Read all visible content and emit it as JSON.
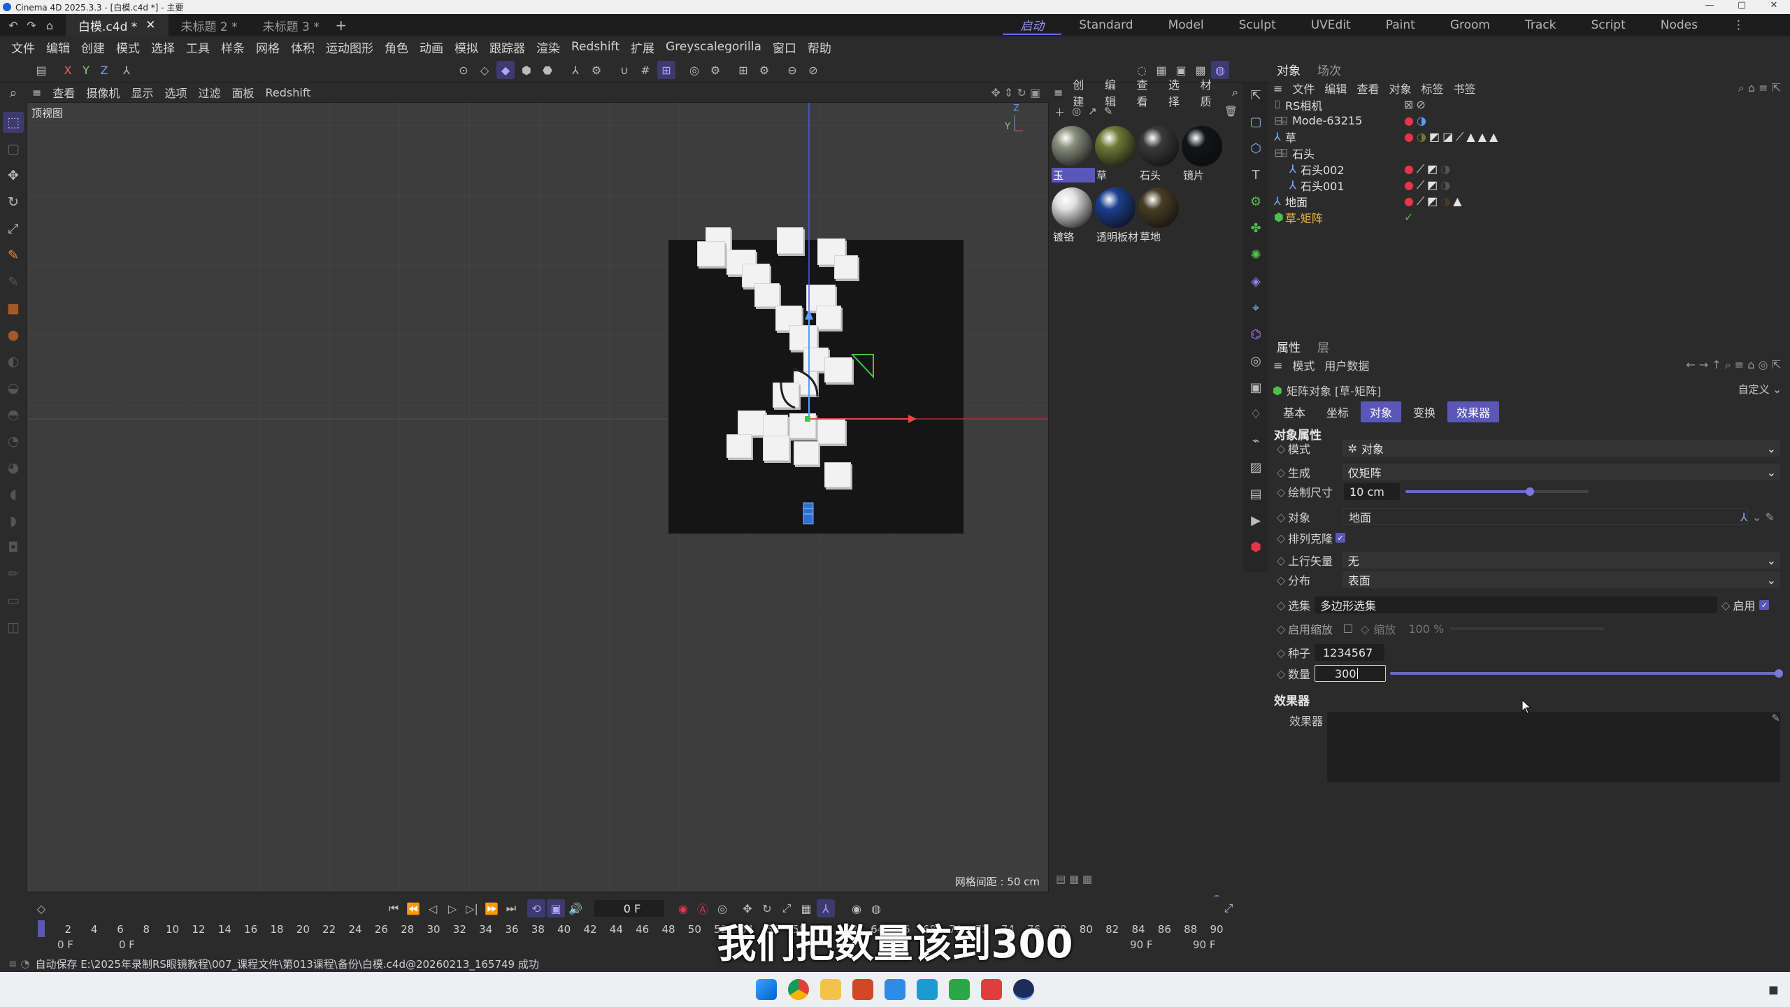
{
  "window": {
    "title": "Cinema 4D 2025.3.3 - [白模.c4d *] - 主要",
    "controls": [
      "—",
      "▢",
      "✕"
    ]
  },
  "tabs": [
    {
      "label": "白模.c4d *",
      "active": true
    },
    {
      "label": "未标题 2 *"
    },
    {
      "label": "未标题 3 *"
    }
  ],
  "layouts": [
    {
      "label": "启动",
      "active": true
    },
    {
      "label": "Standard"
    },
    {
      "label": "Model"
    },
    {
      "label": "Sculpt"
    },
    {
      "label": "UVEdit"
    },
    {
      "label": "Paint"
    },
    {
      "label": "Groom"
    },
    {
      "label": "Track"
    },
    {
      "label": "Script"
    },
    {
      "label": "Nodes"
    }
  ],
  "menu": [
    "文件",
    "编辑",
    "创建",
    "模式",
    "选择",
    "工具",
    "样条",
    "网格",
    "体积",
    "运动图形",
    "角色",
    "动画",
    "模拟",
    "跟踪器",
    "渲染",
    "Redshift",
    "扩展",
    "Greyscalegorilla",
    "窗口",
    "帮助"
  ],
  "axis_toggles": [
    "X",
    "Y",
    "Z"
  ],
  "viewport": {
    "menu": [
      "查看",
      "摄像机",
      "显示",
      "选项",
      "过滤",
      "面板",
      "Redshift"
    ],
    "label": "顶视图",
    "grid_info": "网格间距 : 50 cm"
  },
  "materials": {
    "menu": [
      "创建",
      "编辑",
      "查看",
      "选择",
      "材质"
    ],
    "items": [
      {
        "name": "玉",
        "color": "#8a8f7e"
      },
      {
        "name": "草",
        "color": "#6f7a35"
      },
      {
        "name": "石头",
        "color": "#3a3a3a"
      },
      {
        "name": "镜片",
        "color": "#111416"
      },
      {
        "name": "镀铬",
        "color": "#e0e0e0"
      },
      {
        "name": "透明板材",
        "color": "#1c3f8f"
      },
      {
        "name": "草地",
        "color": "#4a3d26"
      }
    ]
  },
  "object_manager": {
    "tabs": [
      "对象",
      "场次"
    ],
    "menu": [
      "文件",
      "编辑",
      "查看",
      "对象",
      "标签",
      "书签"
    ],
    "tree": [
      {
        "name": "RS相机",
        "indent": 0
      },
      {
        "name": "Mode-63215",
        "indent": 0
      },
      {
        "name": "草",
        "indent": 0
      },
      {
        "name": "石头",
        "indent": 0
      },
      {
        "name": "石头002",
        "indent": 1
      },
      {
        "name": "石头001",
        "indent": 1
      },
      {
        "name": "地面",
        "indent": 0
      },
      {
        "name": "草-矩阵",
        "indent": 0,
        "selected": true
      }
    ]
  },
  "attributes": {
    "tabs": [
      "属性",
      "层"
    ],
    "menu": [
      "模式",
      "用户数据"
    ],
    "object_title": "矩阵对象 [草-矩阵]",
    "preset": "自定义",
    "subtabs": [
      {
        "label": "基本"
      },
      {
        "label": "坐标"
      },
      {
        "label": "对象",
        "active": true
      },
      {
        "label": "变换"
      },
      {
        "label": "效果器",
        "active": true
      }
    ],
    "section": "对象属性",
    "mode_label": "模式",
    "mode_value": "对象",
    "generate_label": "生成",
    "generate_value": "仅矩阵",
    "draw_size_label": "绘制尺寸",
    "draw_size_value": "10 cm",
    "draw_size_fraction": 0.68,
    "object_label": "对象",
    "object_value": "地面",
    "arrange_label": "排列克隆",
    "up_label": "上行矢量",
    "up_value": "无",
    "dist_label": "分布",
    "dist_value": "表面",
    "sel_label": "选集",
    "sel_value": "多边形选集",
    "enable_label": "启用",
    "scale_label": "启用缩放",
    "scale_sub": "缩放",
    "scale_value": "100 %",
    "seed_label": "种子",
    "seed_value": "1234567",
    "count_label": "数量",
    "count_value": "300",
    "count_fraction": 1.0,
    "effectors_section": "效果器",
    "effectors_label": "效果器"
  },
  "timeline": {
    "ticks": [
      "0",
      "2",
      "4",
      "6",
      "8",
      "10",
      "12",
      "14",
      "16",
      "18",
      "20",
      "22",
      "24",
      "26",
      "28",
      "30",
      "32",
      "34",
      "36",
      "38",
      "40",
      "42",
      "44",
      "46",
      "48",
      "50",
      "52",
      "54",
      "56",
      "58",
      "60",
      "62",
      "64",
      "66",
      "68",
      "70",
      "72",
      "74",
      "76",
      "78",
      "80",
      "82",
      "84",
      "86",
      "88",
      "90"
    ],
    "current_frame": "0 F",
    "start_a": "0 F",
    "start_b": "0 F",
    "end_a": "90 F",
    "end_b": "90 F"
  },
  "status": "自动保存 E:\\2025年录制RS眼镜教程\\007_课程文件\\第013课程\\备份\\白模.c4d@20260213_165749 成功",
  "subtitle": "我们把数量该到300"
}
